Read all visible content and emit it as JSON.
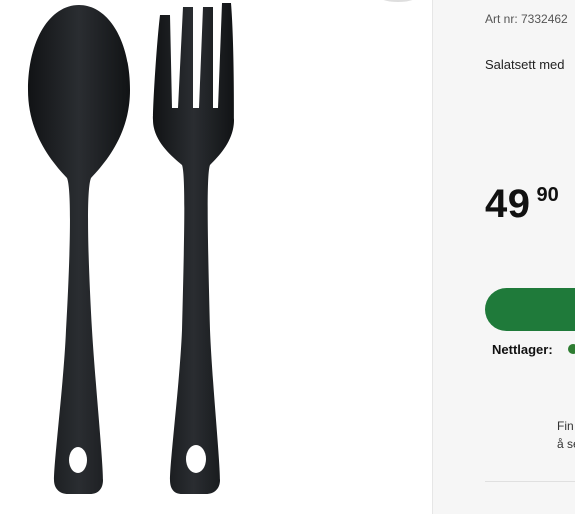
{
  "product": {
    "art_nr": "Art nr: 7332462",
    "title": "Salatsett med",
    "price_main": "49",
    "price_decimals": "90",
    "stock_label": "Nettlager:",
    "find_line1": "Fin",
    "find_line2": "å se"
  },
  "colors": {
    "buy_button": "#1f7a3a",
    "stock_dot": "#2e7d32",
    "utensil": "#1b1d20"
  },
  "icons": {
    "stock_status": "green-dot-icon"
  }
}
